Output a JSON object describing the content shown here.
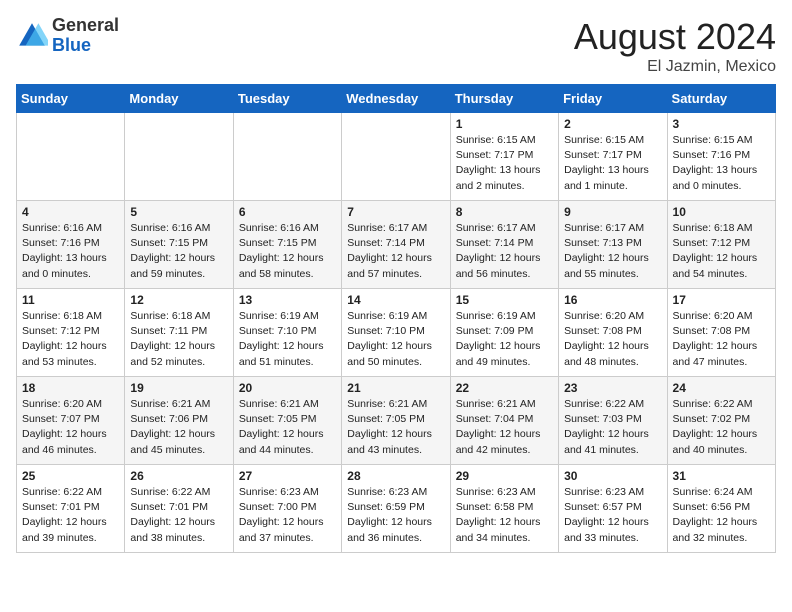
{
  "logo": {
    "general": "General",
    "blue": "Blue"
  },
  "title": {
    "month_year": "August 2024",
    "location": "El Jazmin, Mexico"
  },
  "days_of_week": [
    "Sunday",
    "Monday",
    "Tuesday",
    "Wednesday",
    "Thursday",
    "Friday",
    "Saturday"
  ],
  "weeks": [
    [
      {
        "day": "",
        "info": ""
      },
      {
        "day": "",
        "info": ""
      },
      {
        "day": "",
        "info": ""
      },
      {
        "day": "",
        "info": ""
      },
      {
        "day": "1",
        "info": "Sunrise: 6:15 AM\nSunset: 7:17 PM\nDaylight: 13 hours\nand 2 minutes."
      },
      {
        "day": "2",
        "info": "Sunrise: 6:15 AM\nSunset: 7:17 PM\nDaylight: 13 hours\nand 1 minute."
      },
      {
        "day": "3",
        "info": "Sunrise: 6:15 AM\nSunset: 7:16 PM\nDaylight: 13 hours\nand 0 minutes."
      }
    ],
    [
      {
        "day": "4",
        "info": "Sunrise: 6:16 AM\nSunset: 7:16 PM\nDaylight: 13 hours\nand 0 minutes."
      },
      {
        "day": "5",
        "info": "Sunrise: 6:16 AM\nSunset: 7:15 PM\nDaylight: 12 hours\nand 59 minutes."
      },
      {
        "day": "6",
        "info": "Sunrise: 6:16 AM\nSunset: 7:15 PM\nDaylight: 12 hours\nand 58 minutes."
      },
      {
        "day": "7",
        "info": "Sunrise: 6:17 AM\nSunset: 7:14 PM\nDaylight: 12 hours\nand 57 minutes."
      },
      {
        "day": "8",
        "info": "Sunrise: 6:17 AM\nSunset: 7:14 PM\nDaylight: 12 hours\nand 56 minutes."
      },
      {
        "day": "9",
        "info": "Sunrise: 6:17 AM\nSunset: 7:13 PM\nDaylight: 12 hours\nand 55 minutes."
      },
      {
        "day": "10",
        "info": "Sunrise: 6:18 AM\nSunset: 7:12 PM\nDaylight: 12 hours\nand 54 minutes."
      }
    ],
    [
      {
        "day": "11",
        "info": "Sunrise: 6:18 AM\nSunset: 7:12 PM\nDaylight: 12 hours\nand 53 minutes."
      },
      {
        "day": "12",
        "info": "Sunrise: 6:18 AM\nSunset: 7:11 PM\nDaylight: 12 hours\nand 52 minutes."
      },
      {
        "day": "13",
        "info": "Sunrise: 6:19 AM\nSunset: 7:10 PM\nDaylight: 12 hours\nand 51 minutes."
      },
      {
        "day": "14",
        "info": "Sunrise: 6:19 AM\nSunset: 7:10 PM\nDaylight: 12 hours\nand 50 minutes."
      },
      {
        "day": "15",
        "info": "Sunrise: 6:19 AM\nSunset: 7:09 PM\nDaylight: 12 hours\nand 49 minutes."
      },
      {
        "day": "16",
        "info": "Sunrise: 6:20 AM\nSunset: 7:08 PM\nDaylight: 12 hours\nand 48 minutes."
      },
      {
        "day": "17",
        "info": "Sunrise: 6:20 AM\nSunset: 7:08 PM\nDaylight: 12 hours\nand 47 minutes."
      }
    ],
    [
      {
        "day": "18",
        "info": "Sunrise: 6:20 AM\nSunset: 7:07 PM\nDaylight: 12 hours\nand 46 minutes."
      },
      {
        "day": "19",
        "info": "Sunrise: 6:21 AM\nSunset: 7:06 PM\nDaylight: 12 hours\nand 45 minutes."
      },
      {
        "day": "20",
        "info": "Sunrise: 6:21 AM\nSunset: 7:05 PM\nDaylight: 12 hours\nand 44 minutes."
      },
      {
        "day": "21",
        "info": "Sunrise: 6:21 AM\nSunset: 7:05 PM\nDaylight: 12 hours\nand 43 minutes."
      },
      {
        "day": "22",
        "info": "Sunrise: 6:21 AM\nSunset: 7:04 PM\nDaylight: 12 hours\nand 42 minutes."
      },
      {
        "day": "23",
        "info": "Sunrise: 6:22 AM\nSunset: 7:03 PM\nDaylight: 12 hours\nand 41 minutes."
      },
      {
        "day": "24",
        "info": "Sunrise: 6:22 AM\nSunset: 7:02 PM\nDaylight: 12 hours\nand 40 minutes."
      }
    ],
    [
      {
        "day": "25",
        "info": "Sunrise: 6:22 AM\nSunset: 7:01 PM\nDaylight: 12 hours\nand 39 minutes."
      },
      {
        "day": "26",
        "info": "Sunrise: 6:22 AM\nSunset: 7:01 PM\nDaylight: 12 hours\nand 38 minutes."
      },
      {
        "day": "27",
        "info": "Sunrise: 6:23 AM\nSunset: 7:00 PM\nDaylight: 12 hours\nand 37 minutes."
      },
      {
        "day": "28",
        "info": "Sunrise: 6:23 AM\nSunset: 6:59 PM\nDaylight: 12 hours\nand 36 minutes."
      },
      {
        "day": "29",
        "info": "Sunrise: 6:23 AM\nSunset: 6:58 PM\nDaylight: 12 hours\nand 34 minutes."
      },
      {
        "day": "30",
        "info": "Sunrise: 6:23 AM\nSunset: 6:57 PM\nDaylight: 12 hours\nand 33 minutes."
      },
      {
        "day": "31",
        "info": "Sunrise: 6:24 AM\nSunset: 6:56 PM\nDaylight: 12 hours\nand 32 minutes."
      }
    ]
  ]
}
